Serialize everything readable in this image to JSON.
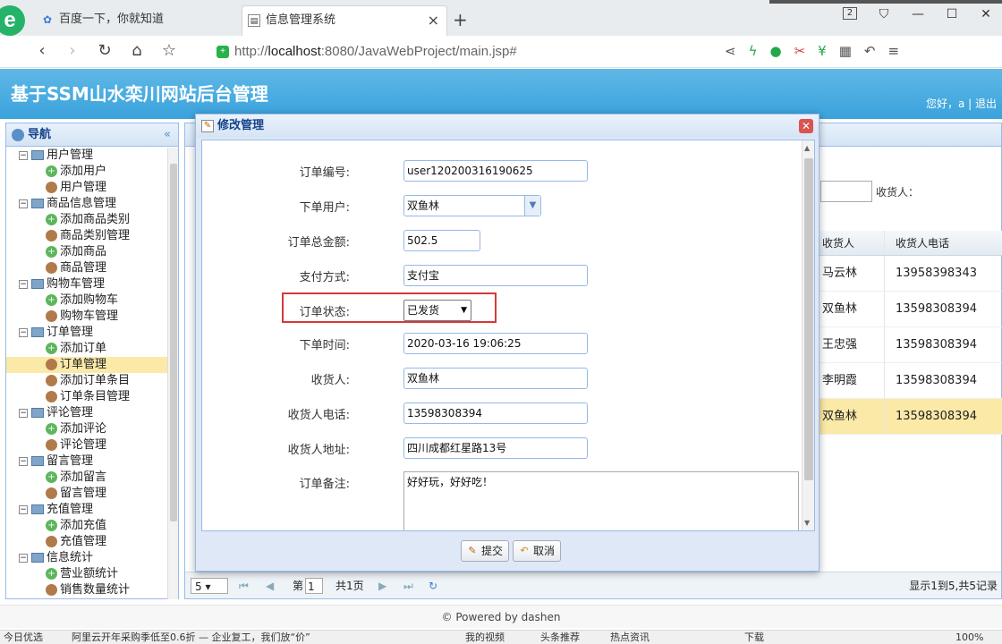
{
  "browser": {
    "tabs": [
      {
        "label": "百度一下，你就知道",
        "icon": "paw-icon"
      },
      {
        "label": "信息管理系统",
        "icon": "page-icon"
      }
    ],
    "address_prefix": "http://",
    "address_host": "localhost",
    "address_path": ":8080/JavaWebProject/main.jsp#",
    "tab_count_badge": "2"
  },
  "app": {
    "title": "基于SSM山水栾川网站后台管理",
    "user_info": "您好，a | 退出"
  },
  "sidebar": {
    "header": "导航",
    "collapse_glyph": "«",
    "rows": [
      {
        "type": "group",
        "label": "用户管理"
      },
      {
        "type": "leaf",
        "icon": "add",
        "label": "添加用户"
      },
      {
        "type": "leaf",
        "icon": "user",
        "label": "用户管理"
      },
      {
        "type": "group",
        "label": "商品信息管理"
      },
      {
        "type": "leaf",
        "icon": "add",
        "label": "添加商品类别"
      },
      {
        "type": "leaf",
        "icon": "user",
        "label": "商品类别管理"
      },
      {
        "type": "leaf",
        "icon": "add",
        "label": "添加商品"
      },
      {
        "type": "leaf",
        "icon": "user",
        "label": "商品管理"
      },
      {
        "type": "group",
        "label": "购物车管理"
      },
      {
        "type": "leaf",
        "icon": "add",
        "label": "添加购物车"
      },
      {
        "type": "leaf",
        "icon": "user",
        "label": "购物车管理"
      },
      {
        "type": "group",
        "label": "订单管理"
      },
      {
        "type": "leaf",
        "icon": "add",
        "label": "添加订单"
      },
      {
        "type": "leaf",
        "icon": "user",
        "label": "订单管理",
        "selected": true
      },
      {
        "type": "leaf",
        "icon": "user",
        "label": "添加订单条目"
      },
      {
        "type": "leaf",
        "icon": "user",
        "label": "订单条目管理"
      },
      {
        "type": "group",
        "label": "评论管理"
      },
      {
        "type": "leaf",
        "icon": "add",
        "label": "添加评论"
      },
      {
        "type": "leaf",
        "icon": "user",
        "label": "评论管理"
      },
      {
        "type": "group",
        "label": "留言管理"
      },
      {
        "type": "leaf",
        "icon": "add",
        "label": "添加留言"
      },
      {
        "type": "leaf",
        "icon": "user",
        "label": "留言管理"
      },
      {
        "type": "group",
        "label": "充值管理"
      },
      {
        "type": "leaf",
        "icon": "add",
        "label": "添加充值"
      },
      {
        "type": "leaf",
        "icon": "user",
        "label": "充值管理"
      },
      {
        "type": "group",
        "label": "信息统计"
      },
      {
        "type": "leaf",
        "icon": "add",
        "label": "营业额统计"
      },
      {
        "type": "leaf",
        "icon": "user",
        "label": "销售数量统计"
      }
    ]
  },
  "main": {
    "search_label": "收货人：",
    "grid_headers": [
      "收货人",
      "收货人电话"
    ],
    "grid_rows": [
      [
        "马云林",
        "13958398343"
      ],
      [
        "双鱼林",
        "13598308394"
      ],
      [
        "王忠强",
        "13598308394"
      ],
      [
        "李明霞",
        "13598308394"
      ],
      [
        "双鱼林",
        "13598308394"
      ]
    ],
    "pager": {
      "page_size": "5",
      "page_prefix": "第",
      "page_value": "1",
      "page_total": "共1页",
      "info": "显示1到5,共5记录"
    }
  },
  "footer": "© Powered by dashen",
  "statusbar": {
    "left": "今日优选",
    "news": "阿里云开年采购季低至0.6折 — 企业复工，我们放“价”",
    "items": [
      "我的视频",
      "头条推荐",
      "热点资讯",
      "下载",
      "100%"
    ]
  },
  "modal": {
    "title": "修改管理",
    "fields": [
      {
        "label": "订单编号:",
        "value": "user120200316190625",
        "kind": "text"
      },
      {
        "label": "下单用户:",
        "value": "双鱼林",
        "kind": "combo"
      },
      {
        "label": "订单总金额:",
        "value": "502.5",
        "kind": "short"
      },
      {
        "label": "支付方式:",
        "value": "支付宝",
        "kind": "text"
      },
      {
        "label": "订单状态:",
        "value": "已发货",
        "kind": "select"
      },
      {
        "label": "下单时间:",
        "value": "2020-03-16 19:06:25",
        "kind": "text"
      },
      {
        "label": "收货人:",
        "value": "双鱼林",
        "kind": "text"
      },
      {
        "label": "收货人电话:",
        "value": "13598308394",
        "kind": "text"
      },
      {
        "label": "收货人地址:",
        "value": "四川成都红星路13号",
        "kind": "text"
      },
      {
        "label": "订单备注:",
        "value": "好好玩，好好吃！",
        "kind": "textarea"
      }
    ],
    "submit_label": "提交",
    "cancel_label": "取消"
  }
}
